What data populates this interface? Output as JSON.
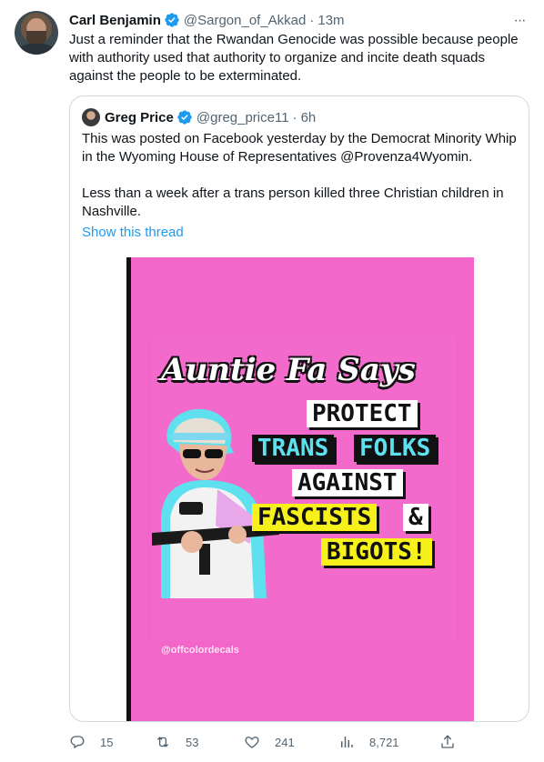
{
  "tweet": {
    "author_name": "Carl Benjamin",
    "author_handle": "@Sargon_of_Akkad",
    "separator": "·",
    "time": "13m",
    "more_label": "···",
    "text": "Just a reminder that the Rwandan Genocide was possible because people with authority used that authority to organize and incite death squads against the people to be exterminated."
  },
  "quote": {
    "author_name": "Greg Price",
    "author_handle": "@greg_price11",
    "separator": "·",
    "time": "6h",
    "paragraph1": "This was posted on Facebook yesterday by the Democrat Minority Whip in the Wyoming House of Representatives @Provenza4Wyomin.",
    "paragraph2": "Less than a week after a trans person killed three Christian children in Nashville.",
    "show_thread": "Show this thread",
    "image": {
      "headline": "Auntie Fa Says",
      "words": [
        "PROTECT",
        "TRANS",
        "FOLKS",
        "AGAINST",
        "FASCISTS",
        "&",
        "BIGOTS!"
      ],
      "credit": "@offcolordecals",
      "colors": {
        "background": "#f366c9",
        "yellow": "#f7f11b",
        "cyan": "#5ee0ef"
      }
    }
  },
  "actions": {
    "replies": "15",
    "retweets": "53",
    "likes": "241",
    "views": "8,721"
  },
  "colors": {
    "accent": "#1d9bf0",
    "muted": "#536471",
    "border": "#cfd9de"
  }
}
